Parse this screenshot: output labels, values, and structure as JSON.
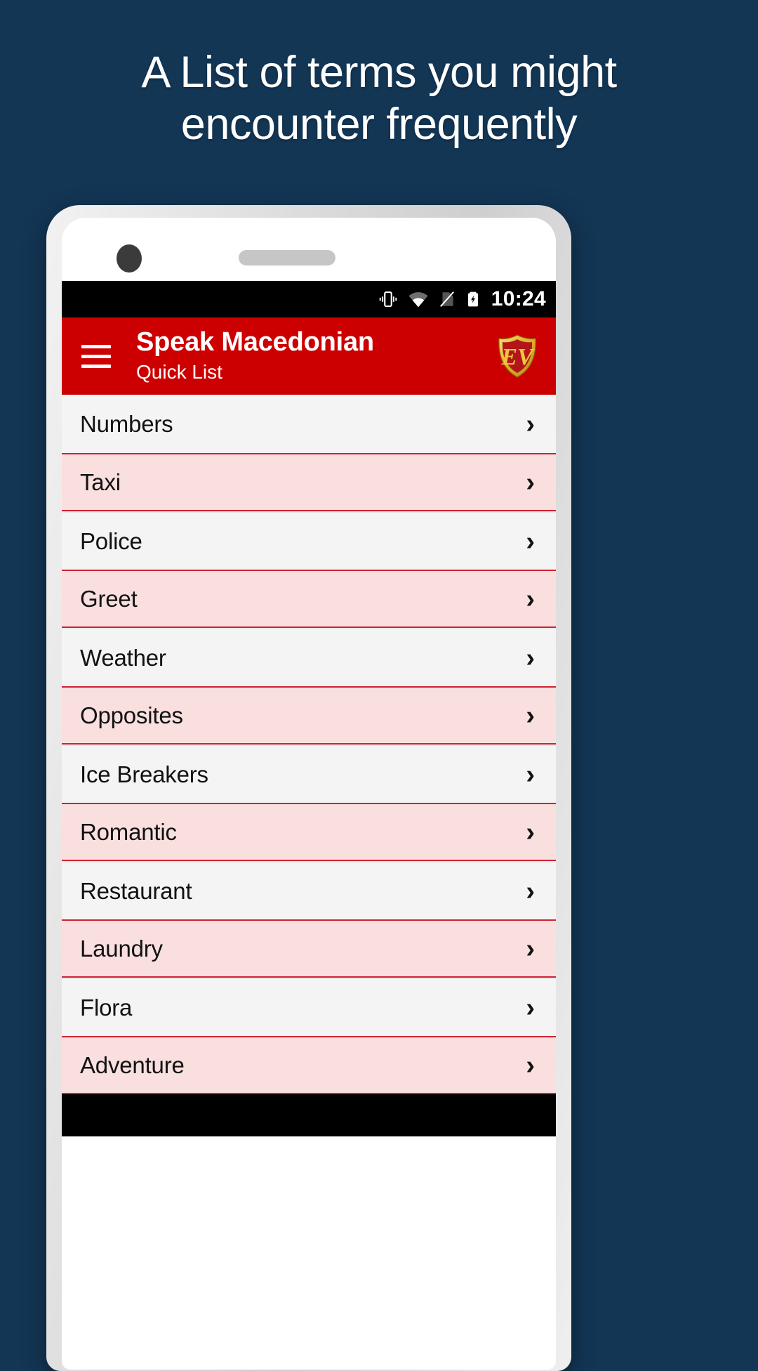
{
  "promo": {
    "headline": "A List of terms you might\nencounter frequently",
    "background_color": "#133655",
    "text_color": "#ffffff"
  },
  "status_bar": {
    "time": "10:24",
    "icons": [
      "vibrate-icon",
      "wifi-icon",
      "sim-card-off-icon",
      "battery-charging-icon"
    ],
    "background_color": "#000000"
  },
  "app_bar": {
    "menu_icon": "hamburger-menu-icon",
    "title": "Speak Macedonian",
    "subtitle": "Quick List",
    "logo_text": "EV",
    "background_color": "#cc0000",
    "logo_colors": {
      "shield": "#e8c33a",
      "letters": "#a8201a"
    }
  },
  "quick_list": {
    "chevron": "›",
    "row_colors": {
      "odd": "#f4f4f4",
      "even": "#fadfdf",
      "divider": "#cf2233"
    },
    "items": [
      {
        "label": "Numbers"
      },
      {
        "label": "Taxi"
      },
      {
        "label": "Police"
      },
      {
        "label": "Greet"
      },
      {
        "label": "Weather"
      },
      {
        "label": "Opposites"
      },
      {
        "label": "Ice Breakers"
      },
      {
        "label": "Romantic"
      },
      {
        "label": "Restaurant"
      },
      {
        "label": "Laundry"
      },
      {
        "label": "Flora"
      },
      {
        "label": "Adventure"
      }
    ]
  }
}
